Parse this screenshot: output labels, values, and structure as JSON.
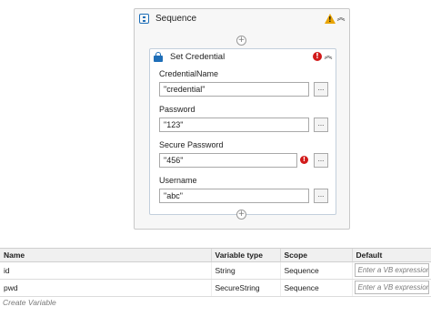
{
  "sequence": {
    "title": "Sequence",
    "warning_icon": "warning-triangle-icon",
    "collapse_icon": "double-chevron-up-icon"
  },
  "activity": {
    "title": "Set Credential",
    "error_icon": "error-icon",
    "fields": [
      {
        "label": "CredentialName",
        "value": "\"credential\""
      },
      {
        "label": "Password",
        "value": "\"123\""
      },
      {
        "label": "Secure Password",
        "value": "\"456\""
      },
      {
        "label": "Username",
        "value": "\"abc\""
      }
    ],
    "browse_label": "..."
  },
  "variables": {
    "columns": [
      "Name",
      "Variable type",
      "Scope",
      "Default"
    ],
    "rows": [
      {
        "name": "id",
        "type": "String",
        "scope": "Sequence",
        "default_placeholder": "Enter a VB expression"
      },
      {
        "name": "pwd",
        "type": "SecureString",
        "scope": "Sequence",
        "default_placeholder": "Enter a VB expression"
      }
    ],
    "create_label": "Create Variable"
  },
  "colors": {
    "accent": "#1f6fb8",
    "warning": "#e9a400",
    "error": "#d21a1a"
  }
}
